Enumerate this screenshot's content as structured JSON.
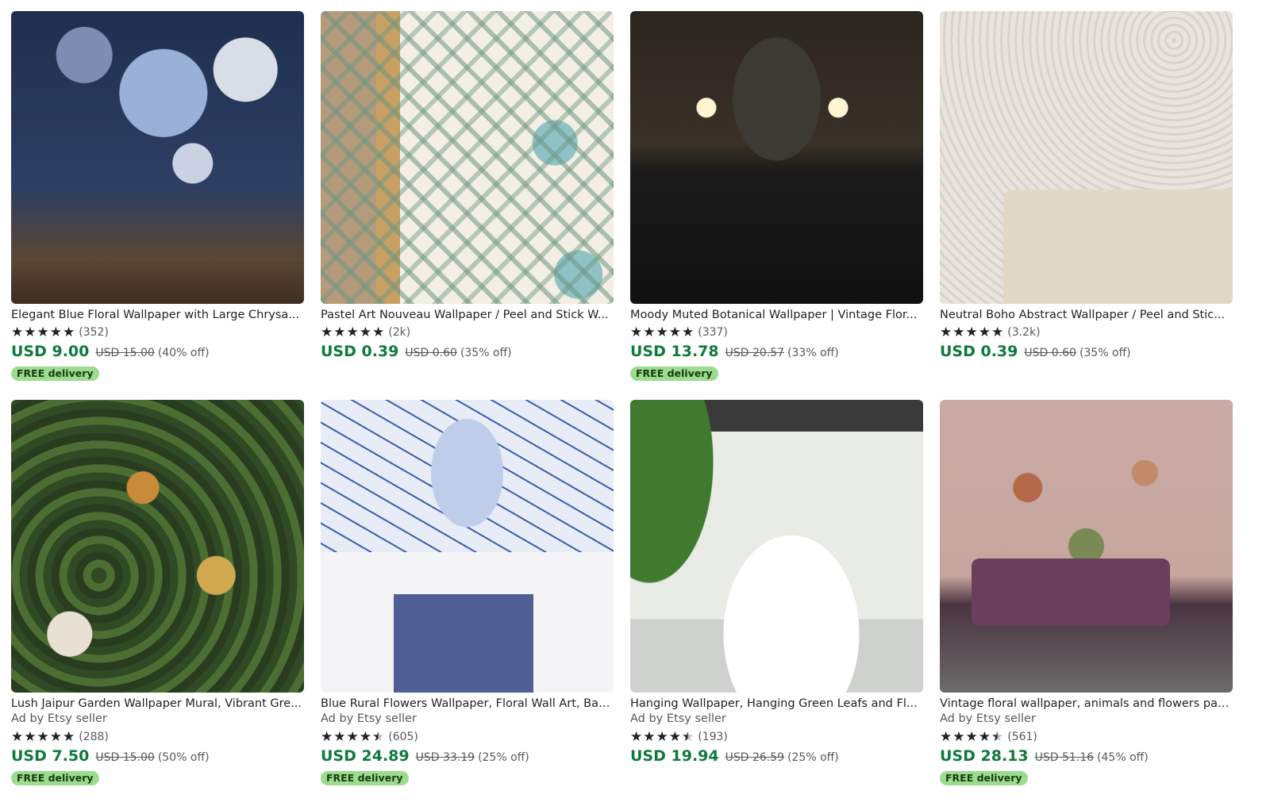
{
  "listings": [
    {
      "title": "Elegant Blue Floral Wallpaper with Large Chrysa...",
      "seller": "",
      "rating": 5,
      "count": "(352)",
      "price": "USD 9.00",
      "original": "USD 15.00",
      "discount": "(40% off)",
      "badge": "FREE delivery",
      "image_icon": "blue-floral-wallpaper-image"
    },
    {
      "title": "Pastel Art Nouveau Wallpaper / Peel and Stick W...",
      "seller": "",
      "rating": 5,
      "count": "(2k)",
      "price": "USD 0.39",
      "original": "USD 0.60",
      "discount": "(35% off)",
      "badge": "",
      "image_icon": "art-nouveau-wallpaper-image"
    },
    {
      "title": "Moody Muted Botanical Wallpaper | Vintage Flor...",
      "seller": "",
      "rating": 5,
      "count": "(337)",
      "price": "USD 13.78",
      "original": "USD 20.57",
      "discount": "(33% off)",
      "badge": "FREE delivery",
      "image_icon": "moody-bathroom-image"
    },
    {
      "title": "Neutral Boho Abstract Wallpaper / Peel and Stic...",
      "seller": "",
      "rating": 5,
      "count": "(3.2k)",
      "price": "USD 0.39",
      "original": "USD 0.60",
      "discount": "(35% off)",
      "badge": "",
      "image_icon": "boho-abstract-image"
    },
    {
      "title": "Lush Jaipur Garden Wallpaper Mural, Vibrant Gre...",
      "seller": "Ad by Etsy seller",
      "rating": 5,
      "count": "(288)",
      "price": "USD 7.50",
      "original": "USD 15.00",
      "discount": "(50% off)",
      "badge": "FREE delivery",
      "image_icon": "jaipur-garden-image"
    },
    {
      "title": "Blue Rural Flowers Wallpaper, Floral Wall Art, Bat...",
      "seller": "Ad by Etsy seller",
      "rating": 4.5,
      "count": "(605)",
      "price": "USD 24.89",
      "original": "USD 33.19",
      "discount": "(25% off)",
      "badge": "FREE delivery",
      "image_icon": "blue-bathroom-image"
    },
    {
      "title": "Hanging Wallpaper, Hanging Green Leafs and Fl...",
      "seller": "Ad by Etsy seller",
      "rating": 4.5,
      "count": "(193)",
      "price": "USD 19.94",
      "original": "USD 26.59",
      "discount": "(25% off)",
      "badge": "",
      "image_icon": "hanging-leaves-bath-image"
    },
    {
      "title": "Vintage floral wallpaper, animals and flowers pat...",
      "seller": "Ad by Etsy seller",
      "rating": 4.5,
      "count": "(561)",
      "price": "USD 28.13",
      "original": "USD 51.16",
      "discount": "(45% off)",
      "badge": "FREE delivery",
      "image_icon": "vintage-floral-room-image"
    }
  ],
  "colors": {
    "price": "#0e7a3b",
    "badge_bg": "#9bdc8e",
    "text": "#222222",
    "muted": "#595959"
  }
}
